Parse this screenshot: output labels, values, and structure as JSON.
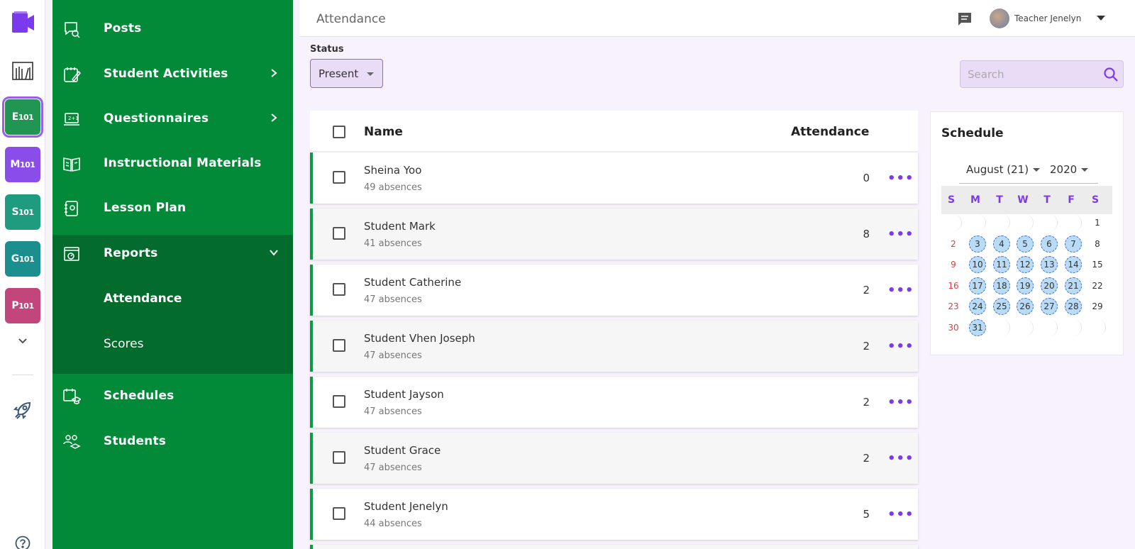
{
  "rail": {
    "classes": [
      {
        "big": "E",
        "small": "101",
        "color": "#219653"
      },
      {
        "big": "M",
        "small": "101",
        "color": "#8b4dea"
      },
      {
        "big": "S",
        "small": "101",
        "color": "#1f9b80"
      },
      {
        "big": "G",
        "small": "101",
        "color": "#1b8e8e"
      },
      {
        "big": "P",
        "small": "101",
        "color": "#c2457c"
      }
    ]
  },
  "sidebar": {
    "items": [
      {
        "label": "Posts"
      },
      {
        "label": "Student Activities"
      },
      {
        "label": "Questionnaires"
      },
      {
        "label": "Instructional Materials"
      },
      {
        "label": "Lesson Plan"
      },
      {
        "label": "Reports"
      },
      {
        "label": "Schedules"
      },
      {
        "label": "Students"
      }
    ],
    "reports_sub": [
      {
        "label": "Attendance"
      },
      {
        "label": "Scores"
      }
    ]
  },
  "header": {
    "title": "Attendance",
    "user": "Teacher Jenelyn"
  },
  "filters": {
    "status_label": "Status",
    "status_value": "Present",
    "search_placeholder": "Search"
  },
  "table": {
    "col_name": "Name",
    "col_attendance": "Attendance",
    "rows": [
      {
        "name": "Sheina Yoo",
        "absences": "49 absences",
        "value": "0"
      },
      {
        "name": "Student Mark",
        "absences": "41 absences",
        "value": "8"
      },
      {
        "name": "Student Catherine",
        "absences": "47 absences",
        "value": "2"
      },
      {
        "name": "Student Vhen Joseph",
        "absences": "47 absences",
        "value": "2"
      },
      {
        "name": "Student Jayson",
        "absences": "47 absences",
        "value": "2"
      },
      {
        "name": "Student Grace",
        "absences": "47 absences",
        "value": "2"
      },
      {
        "name": "Student Jenelyn",
        "absences": "44 absences",
        "value": "5"
      }
    ],
    "more": "•••"
  },
  "schedule": {
    "title": "Schedule",
    "month": "August (21)",
    "year": "2020",
    "dow": [
      "S",
      "M",
      "T",
      "W",
      "T",
      "F",
      "S"
    ],
    "weeks": [
      [
        "",
        "",
        "",
        "",
        "",
        "",
        "1"
      ],
      [
        "2",
        "3",
        "4",
        "5",
        "6",
        "7",
        "8"
      ],
      [
        "9",
        "10",
        "11",
        "12",
        "13",
        "14",
        "15"
      ],
      [
        "16",
        "17",
        "18",
        "19",
        "20",
        "21",
        "22"
      ],
      [
        "23",
        "24",
        "25",
        "26",
        "27",
        "28",
        "29"
      ],
      [
        "30",
        "31",
        "",
        "",
        "",
        "",
        ""
      ]
    ],
    "scheduled_days": [
      "3",
      "4",
      "5",
      "6",
      "7",
      "10",
      "11",
      "12",
      "13",
      "14",
      "17",
      "18",
      "19",
      "20",
      "21",
      "24",
      "25",
      "26",
      "27",
      "28",
      "31"
    ],
    "weekend_color": "#e23b3b",
    "highlight_color": "#b9dbf5"
  },
  "colors": {
    "sidebar_green": "#038a39",
    "sidebar_active": "#036b2c",
    "accent_purple": "#7c3aed",
    "row_border": "#0b9b47"
  }
}
